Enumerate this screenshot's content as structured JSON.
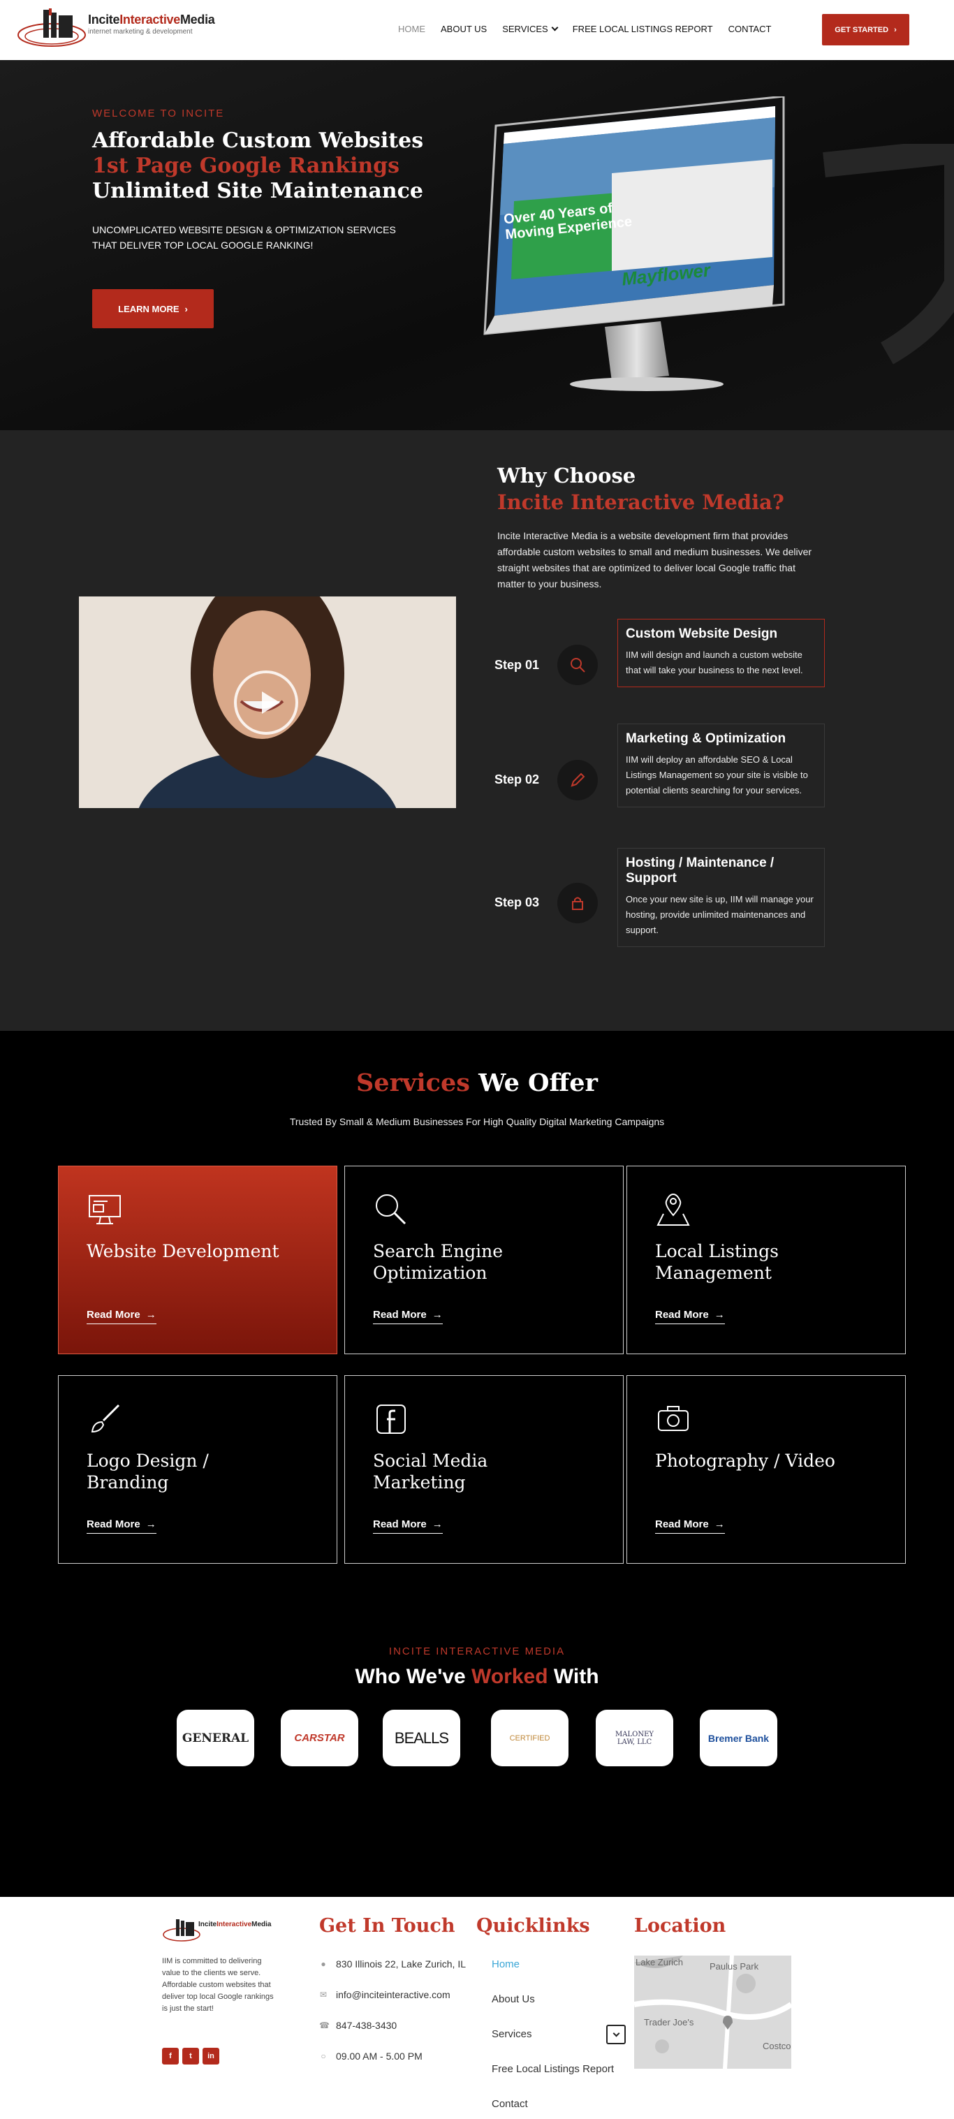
{
  "header": {
    "brand_part1": "Incite",
    "brand_part2": "Interactive",
    "brand_part3": "Media",
    "tagline": "internet marketing & development",
    "nav": [
      "HOME",
      "ABOUT US",
      "SERVICES",
      "FREE LOCAL LISTINGS REPORT",
      "CONTACT"
    ],
    "cta": "GET STARTED"
  },
  "hero": {
    "welcome": "WELCOME TO INCITE",
    "line1": "Affordable Custom Websites",
    "line2": "1st Page Google Rankings",
    "line3": "Unlimited Site Maintenance",
    "lead": "UNCOMPLICATED WEBSITE DESIGN & OPTIMIZATION SERVICES THAT DELIVER TOP LOCAL GOOGLE RANKING!",
    "button": "LEARN MORE",
    "screen_headline_1": "Over 40 Years of",
    "screen_headline_2": "Moving Experience",
    "screen_brand": "Mayflower"
  },
  "why": {
    "title1": "Why Choose",
    "title2": "Incite Interactive Media?",
    "intro": "Incite Interactive Media is a website development firm that provides affordable custom websites to small and medium businesses. We deliver straight websites that are optimized to deliver local Google traffic that matter to your business.",
    "steps": [
      {
        "label": "Step 01",
        "title": "Custom Website Design",
        "text": "IIM will design and launch a custom website that will take your business to the next level.",
        "icon": "search-icon"
      },
      {
        "label": "Step 02",
        "title": "Marketing & Optimization",
        "text": "IIM will deploy an affordable SEO & Local Listings Management so your site is visible to potential clients searching for your services.",
        "icon": "pencil-icon"
      },
      {
        "label": "Step 03",
        "title": "Hosting / Maintenance / Support",
        "text": "Once your new site is up, IIM will manage your hosting, provide unlimited maintenances and support.",
        "icon": "lock-icon"
      }
    ]
  },
  "services": {
    "title_red": "Services",
    "title_white": "We Offer",
    "subtitle": "Trusted By Small & Medium Businesses For High Quality Digital Marketing Campaigns",
    "read_more": "Read More",
    "cards": [
      {
        "title": "Website Development",
        "icon": "monitor-icon"
      },
      {
        "title": "Search Engine Optimization",
        "icon": "search-icon"
      },
      {
        "title": "Local Listings Management",
        "icon": "map-pin-icon"
      },
      {
        "title": "Logo Design / Branding",
        "icon": "brush-icon"
      },
      {
        "title": "Social Media Marketing",
        "icon": "facebook-icon"
      },
      {
        "title": "Photography / Video",
        "icon": "camera-icon"
      }
    ]
  },
  "clients": {
    "kicker": "INCITE INTERACTIVE MEDIA",
    "title_a": "Who We've",
    "title_red": "Worked",
    "title_b": "With",
    "logos": [
      "GENERAL",
      "CARSTAR",
      "BEALLS",
      "CERTIFIED",
      "MALONEY LAW, LLC",
      "Bremer Bank"
    ]
  },
  "footer": {
    "about": "IIM is committed to delivering value to the clients we serve. Affordable custom websites that deliver top local Google rankings is just the start!",
    "get_in_touch": "Get In Touch",
    "address": "830 Illinois 22, Lake Zurich, IL",
    "email": "info@inciteinteractive.com",
    "phone": "847-438-3430",
    "hours": "09.00 AM - 5.00 PM",
    "quicklinks_title": "Quicklinks",
    "quicklinks": [
      "Home",
      "About Us",
      "Services",
      "Free Local Listings Report",
      "Contact"
    ],
    "location_title": "Location",
    "map_labels": [
      "Lake Zurich",
      "Paulus Park",
      "Trader Joe's",
      "Costco"
    ],
    "social": [
      "facebook-icon",
      "twitter-icon",
      "linkedin-icon"
    ]
  }
}
